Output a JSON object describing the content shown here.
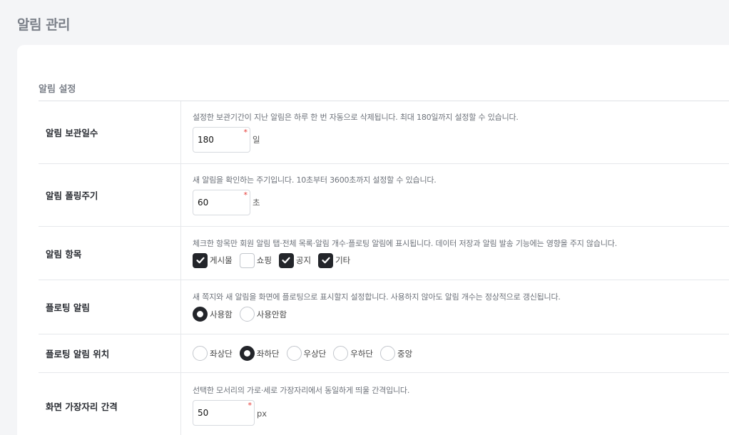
{
  "page": {
    "title": "알림 관리"
  },
  "section": {
    "title": "알림 설정"
  },
  "retention": {
    "label": "알림 보관일수",
    "desc": "설정한 보관기간이 지난 알림은 하루 한 번 자동으로 삭제됩니다. 최대 180일까지 설정할 수 있습니다.",
    "value": "180",
    "required_mark": "*",
    "unit": "일"
  },
  "polling": {
    "label": "알림 폴링주기",
    "desc": "새 알림을 확인하는 주기입니다. 10초부터 3600초까지 설정할 수 있습니다.",
    "value": "60",
    "required_mark": "*",
    "unit": "초"
  },
  "items": {
    "label": "알림 항목",
    "desc": "체크한 항목만 회원 알림 탭·전체 목록·알림 개수·플로팅 알림에 표시됩니다. 데이터 저장과 알림 발송 기능에는 영향을 주지 않습니다.",
    "options": [
      {
        "label": "게시물",
        "checked": true
      },
      {
        "label": "쇼핑",
        "checked": false
      },
      {
        "label": "공지",
        "checked": true
      },
      {
        "label": "기타",
        "checked": true
      }
    ]
  },
  "floating": {
    "label": "플로팅 알림",
    "desc": "새 쪽지와 새 알림을 화면에 플로팅으로 표시할지 설정합니다. 사용하지 않아도 알림 개수는 정상적으로 갱신됩니다.",
    "options": [
      {
        "label": "사용함",
        "selected": true
      },
      {
        "label": "사용안함",
        "selected": false
      }
    ]
  },
  "position": {
    "label": "플로팅 알림 위치",
    "options": [
      {
        "label": "좌상단",
        "selected": false
      },
      {
        "label": "좌하단",
        "selected": true
      },
      {
        "label": "우상단",
        "selected": false
      },
      {
        "label": "우하단",
        "selected": false
      },
      {
        "label": "중앙",
        "selected": false
      }
    ]
  },
  "edge_gap": {
    "label": "화면 가장자리 간격",
    "desc": "선택한 모서리의 가로·세로 가장자리에서 동일하게 띄울 간격입니다.",
    "value": "50",
    "required_mark": "*",
    "unit": "px"
  },
  "colors": {
    "accent": "#23252a",
    "required": "#e53935",
    "title": "#7b8089"
  }
}
